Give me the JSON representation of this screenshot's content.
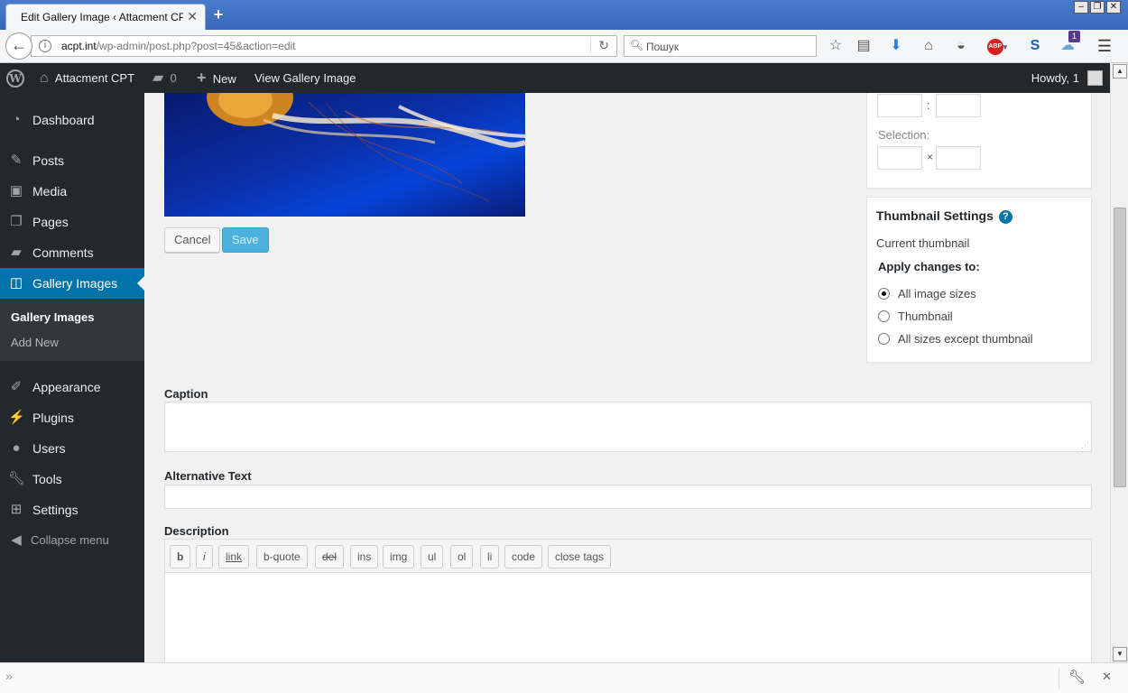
{
  "browser": {
    "tab_title": "Edit Gallery Image ‹ Attacment CP…",
    "url_host": "acpt.int",
    "url_path": "/wp-admin/post.php?post=45&action=edit",
    "search_placeholder": "Пошук",
    "notification_count": "1",
    "abp_label": "ABP"
  },
  "adminbar": {
    "site_name": "Attacment CPT",
    "comments_count": "0",
    "new_label": "New",
    "view_label": "View Gallery Image",
    "howdy": "Howdy, 1"
  },
  "sidebar": {
    "items": [
      {
        "label": "Dashboard",
        "icon": "dashboard-icon"
      },
      {
        "label": "Posts",
        "icon": "pin-icon"
      },
      {
        "label": "Media",
        "icon": "media-icon"
      },
      {
        "label": "Pages",
        "icon": "pages-icon"
      },
      {
        "label": "Comments",
        "icon": "comment-icon"
      },
      {
        "label": "Gallery Images",
        "icon": "gallery-icon"
      },
      {
        "label": "Appearance",
        "icon": "brush-icon"
      },
      {
        "label": "Plugins",
        "icon": "plugin-icon"
      },
      {
        "label": "Users",
        "icon": "user-icon"
      },
      {
        "label": "Tools",
        "icon": "wrench-icon"
      },
      {
        "label": "Settings",
        "icon": "settings-icon"
      }
    ],
    "submenu": [
      "Gallery Images",
      "Add New"
    ],
    "collapse_label": "Collapse menu"
  },
  "editor": {
    "cancel_label": "Cancel",
    "save_label": "Save"
  },
  "crop_box": {
    "ratio_separator": ":",
    "selection_label": "Selection:",
    "selection_separator": "×"
  },
  "thumbnail_settings": {
    "title": "Thumbnail Settings",
    "help": "?",
    "current_thumbnail": "Current thumbnail",
    "apply_label": "Apply changes to:",
    "options": [
      {
        "label": "All image sizes",
        "checked": true
      },
      {
        "label": "Thumbnail",
        "checked": false
      },
      {
        "label": "All sizes except thumbnail",
        "checked": false
      }
    ]
  },
  "fields": {
    "caption_label": "Caption",
    "alt_label": "Alternative Text",
    "description_label": "Description"
  },
  "quicktags": [
    "b",
    "i",
    "link",
    "b-quote",
    "del",
    "ins",
    "img",
    "ul",
    "ol",
    "li",
    "code",
    "close tags"
  ],
  "colors": {
    "admin_dark": "#23282d",
    "active_blue": "#0073aa",
    "primary_button": "#4db1de"
  }
}
